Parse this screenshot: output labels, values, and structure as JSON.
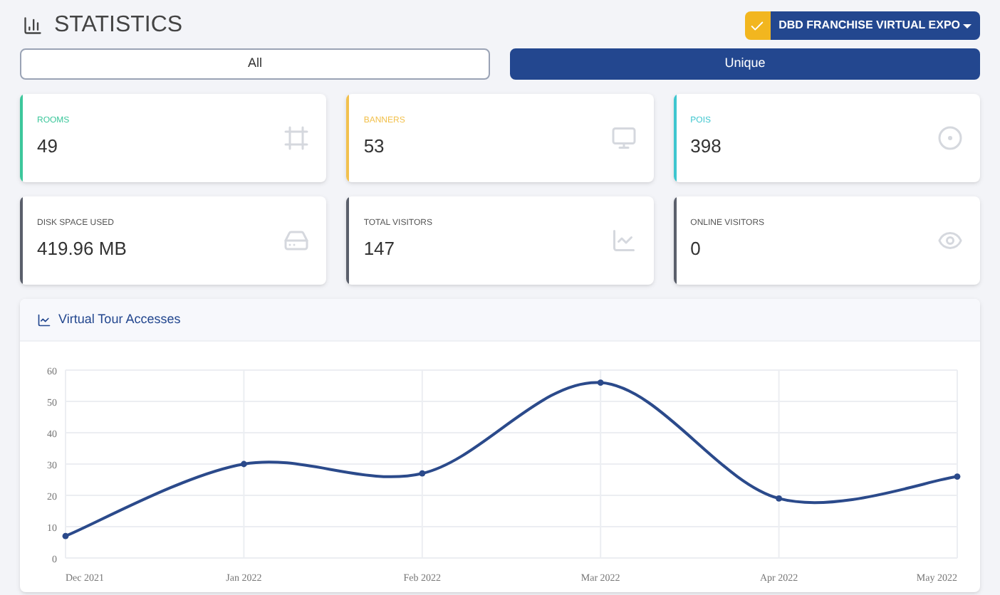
{
  "header": {
    "title": "STATISTICS",
    "event_button": "DBD FRANCHISE VIRTUAL EXPO"
  },
  "tabs": [
    {
      "label": "All",
      "selected": false
    },
    {
      "label": "Unique",
      "selected": true
    }
  ],
  "cards": [
    {
      "label": "ROOMS",
      "value": "49",
      "color": "#3cc79b",
      "kind": "rooms"
    },
    {
      "label": "BANNERS",
      "value": "53",
      "color": "#f2c14e",
      "kind": "banners"
    },
    {
      "label": "POIS",
      "value": "398",
      "color": "#3ec6cf",
      "kind": "pois"
    },
    {
      "label": "DISK SPACE USED",
      "value": "419.96 MB",
      "color": "#5a5f6b",
      "kind": "disk"
    },
    {
      "label": "TOTAL VISITORS",
      "value": "147",
      "color": "#5a5f6b",
      "kind": "visitors"
    },
    {
      "label": "ONLINE VISITORS",
      "value": "0",
      "color": "#5a5f6b",
      "kind": "online"
    }
  ],
  "chart_panel": {
    "title": "Virtual Tour Accesses",
    "chart_data": {
      "type": "line",
      "categories": [
        "Dec 2021",
        "Jan 2022",
        "Feb 2022",
        "Mar 2022",
        "Apr 2022",
        "May 2022"
      ],
      "series": [
        {
          "color": "#2b4a8b",
          "marker": true,
          "values": [
            7,
            30,
            27,
            56,
            19,
            26
          ]
        }
      ],
      "grid": true,
      "ylim": [
        0,
        60
      ],
      "yticks": [
        0,
        10,
        20,
        30,
        40,
        50,
        60
      ]
    }
  }
}
